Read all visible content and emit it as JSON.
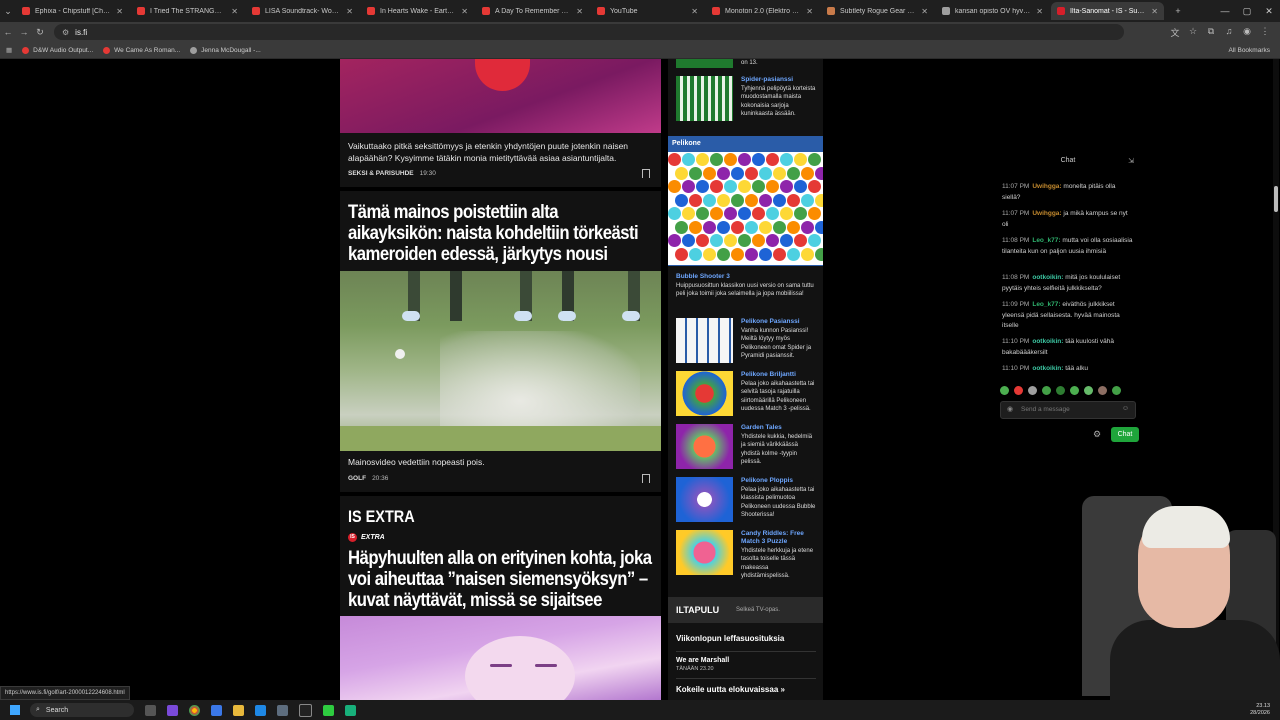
{
  "tabs": [
    {
      "label": "Ephixa - Chipstuff [Chill Out]",
      "color": "#e53935"
    },
    {
      "label": "I Tried The STRANGEST Food",
      "color": "#e53935"
    },
    {
      "label": "LISA Soundtrack- Work Hard",
      "color": "#e53935"
    },
    {
      "label": "In Hearts Wake - Earthwalker",
      "color": "#e53935"
    },
    {
      "label": "A Day To Remember - Homes",
      "color": "#e53935"
    },
    {
      "label": "YouTube",
      "color": "#e53935"
    },
    {
      "label": "Monoton 2.0 (Elektro Pop)",
      "color": "#e53935"
    },
    {
      "label": "Subtlety Rogue Gear and Best",
      "color": "#c97b4a"
    },
    {
      "label": "kansan opisto OV hyväksiluku",
      "color": "#9e9e9e"
    },
    {
      "label": "Ilta-Sanomat - IS - Suomen suu",
      "color": "#d61f2a"
    }
  ],
  "address": {
    "url": "is.fi"
  },
  "bookmarks": [
    {
      "label": "D&W Audio Output...",
      "color": "#e53935"
    },
    {
      "label": "We Came As Roman...",
      "color": "#e53935"
    },
    {
      "label": "Jenna McDougall -...",
      "color": "#9e9e9e"
    }
  ],
  "all_bookmarks": "All Bookmarks",
  "articles": {
    "teaser1": "Vaikuttaako pitkä seksittömyys ja etenkin yhdyntöjen puute jotenkin naisen alapäähän? Kysyimme tätäkin monia mietityttävää asiaa asiantuntijalta.",
    "meta1_section": "SEKSI & PARISUHDE",
    "meta1_time": "19:30",
    "headline2": "Tämä mainos poistettiin alta aikayksikön: naista kohdeltiin törkeästi kameroiden edessä, järkytys nousi",
    "caption2": "Mainosvideo vedettiin nopeasti pois.",
    "meta2_section": "GOLF",
    "meta2_time": "20:36",
    "extra_heading": "IS EXTRA",
    "extra_badge": "EXTRA",
    "extra_logo": "IS",
    "headline3": "Häpyhuulten alla on erityinen kohta, joka voi aiheuttaa ”naisen siemensyöksyn” – kuvat näyttävät, missä se sijaitsee"
  },
  "sidebar": {
    "top_fragment": "on 13.",
    "spider_title": "Spider-pasianssi",
    "spider_desc": "Tyhjennä pelipöytä korteista muodostamalla maista kokonaisia sarjoja kuninkaasta ässään.",
    "pelikone_label": "Pelikone",
    "bubble_title": "Bubble Shooter 3",
    "bubble_desc": "Huippusuosittun klassikon uusi versio on sama tuttu peli joka toimii joka selaimella ja jopa mobiilissa!",
    "games": [
      {
        "title": "Pelikone Pasianssi",
        "desc": "Vanha kunnon Pasianssi! Meiltä löytyy myös Pelikoneen omat Spider ja Pyramidi pasianssit."
      },
      {
        "title": "Pelikone Briljantti",
        "desc": "Pelaa joko aikahaastetta tai selvitä tasoja rajatuilla siirtomäärillä Pelikoneen uudessa Match 3 -pelissä."
      },
      {
        "title": "Garden Tales",
        "desc": "Yhdistele kukkia, hedelmiä ja siemiä värikkäässä yhdistä kolme -tyypin pelissä."
      },
      {
        "title": "Pelikone Ploppis",
        "desc": "Pelaa joko aikahaastetta tai klassista pelimuotoa Pelikoneen uudessa Bubble Shooterissa!"
      },
      {
        "title": "Candy Riddles: Free Match 3 Puzzle",
        "desc": "Yhdistele herkkuja ja etene tasolta toiselle tässä makeassa yhdistämispelissä."
      }
    ],
    "iltapulu_brand": "ILTAPULU",
    "iltapulu_sub": "Selkeä TV-opas.",
    "iltapulu_item1": "Viikonlopun leffasuosituksia",
    "iltapulu_item2": "We are Marshall",
    "iltapulu_time2": "TÄNÄÄN 23.20",
    "iltapulu_item3": "Kokeile uutta elokuvaissaa »"
  },
  "chat": {
    "title": "Chat",
    "messages": [
      {
        "time": "11:07 PM",
        "user": "Uwihgga:",
        "user_class": "u1",
        "text": "monelta pitäis olla siellä?"
      },
      {
        "time": "11:07 PM",
        "user": "Uwihgga:",
        "user_class": "u1",
        "text": "ja mikä kampus se nyt oli"
      },
      {
        "time": "11:08 PM",
        "user": "Leo_k77:",
        "user_class": "u2",
        "text": "mutta voi olla sosiaalisia tilanteita kun on paljon uusia ihmisiä"
      },
      {
        "time": "11:08 PM",
        "user": "ootkoikin:",
        "user_class": "u3",
        "text": "mitä jos koululaiset pyytäis yhteis selfieitä julkkikselta?"
      },
      {
        "time": "11:09 PM",
        "user": "Leo_k77:",
        "user_class": "u2",
        "text": "eiväthös julkkikset yleensä pidä sellaisesta. hyvää mainosta itselle"
      },
      {
        "time": "11:10 PM",
        "user": "ootkoikin:",
        "user_class": "u3",
        "text": "tää kuulosti vähä bakabäääkersilt"
      },
      {
        "time": "11:10 PM",
        "user": "ootkoikin:",
        "user_class": "u3",
        "text": "tää alku"
      }
    ],
    "input_placeholder": "Send a message",
    "send_label": "Chat"
  },
  "statusbar_url": "https://www.is.fi/golf/art-2000012224608.html",
  "taskbar": {
    "search_label": "Search",
    "time": "23.13",
    "date": "28/2026"
  }
}
